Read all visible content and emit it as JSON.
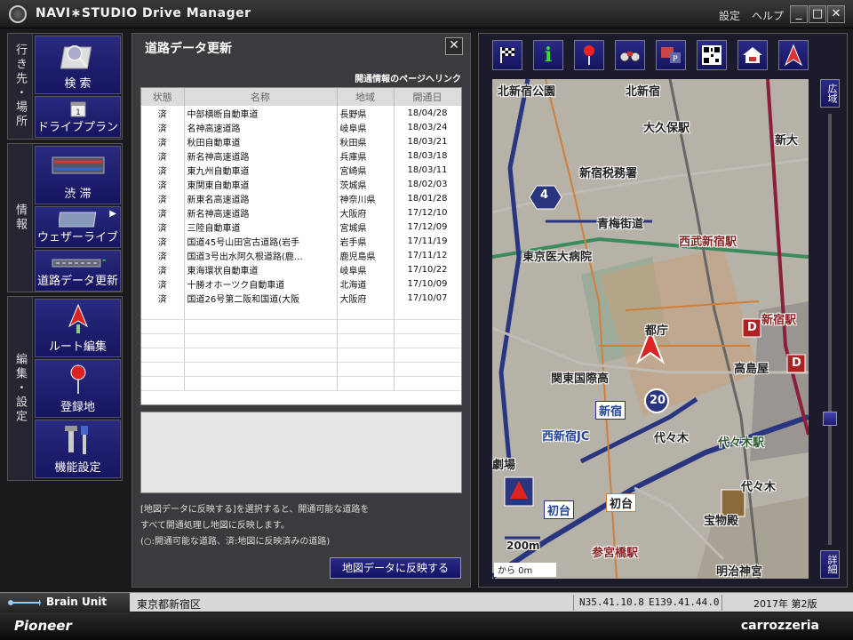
{
  "window": {
    "title": "NAVI∗STUDIO  Drive Manager",
    "settings_label": "設定",
    "help_label": "ヘルプ",
    "minimize": "_",
    "maximize": "□",
    "close": "✕"
  },
  "nav": {
    "groups": [
      {
        "label": "行き先・場所",
        "items": [
          {
            "label": "検 索",
            "icon": "search-icon"
          },
          {
            "label": "ドライブプラン",
            "icon": "calendar-icon"
          }
        ]
      },
      {
        "label": "情報",
        "items": [
          {
            "label": "渋 滞",
            "icon": "traffic-icon"
          },
          {
            "label": "ウェザーライブ",
            "icon": "weather-icon"
          },
          {
            "label": "道路データ更新",
            "icon": "road-update-icon"
          }
        ]
      },
      {
        "label": "編集・設定",
        "items": [
          {
            "label": "ルート編集",
            "icon": "route-icon"
          },
          {
            "label": "登録地",
            "icon": "pin-icon"
          },
          {
            "label": "機能設定",
            "icon": "tools-icon"
          }
        ]
      }
    ],
    "weather_arrow": "▶"
  },
  "panel": {
    "title": "道路データ更新",
    "close": "✕",
    "info_link": "開通情報のページへリンク",
    "columns": [
      "状態",
      "名称",
      "地域",
      "開通日"
    ],
    "rows": [
      [
        "済",
        "中部横断自動車道",
        "長野県",
        "18/04/28"
      ],
      [
        "済",
        "名神高速道路",
        "岐阜県",
        "18/03/24"
      ],
      [
        "済",
        "秋田自動車道",
        "秋田県",
        "18/03/21"
      ],
      [
        "済",
        "新名神高速道路",
        "兵庫県",
        "18/03/18"
      ],
      [
        "済",
        "東九州自動車道",
        "宮崎県",
        "18/03/11"
      ],
      [
        "済",
        "東関東自動車道",
        "茨城県",
        "18/02/03"
      ],
      [
        "済",
        "新東名高速道路",
        "神奈川県",
        "18/01/28"
      ],
      [
        "済",
        "新名神高速道路",
        "大阪府",
        "17/12/10"
      ],
      [
        "済",
        "三陸自動車道",
        "宮城県",
        "17/12/09"
      ],
      [
        "済",
        "国道45号山田宮古道路(岩手",
        "岩手県",
        "17/11/19"
      ],
      [
        "済",
        "国道3号出水阿久根道路(鹿…",
        "鹿児島県",
        "17/11/12"
      ],
      [
        "済",
        "東海環状自動車道",
        "岐阜県",
        "17/10/22"
      ],
      [
        "済",
        "十勝オホーツク自動車道",
        "北海道",
        "17/10/09"
      ],
      [
        "済",
        "国道26号第二阪和国道(大阪",
        "大阪府",
        "17/10/07"
      ]
    ],
    "note_lines": [
      "[地図データに反映する]を選択すると、開通可能な道路を",
      "すべて開通処理し地図に反映します。",
      "(○:開通可能な道路、済:地図に反映済みの道路)"
    ],
    "apply_button": "地図データに反映する"
  },
  "map": {
    "tools": [
      "flag-icon",
      "info-icon",
      "pin-icon",
      "binoculars-icon",
      "parking-icon",
      "qr-icon",
      "home-icon",
      "vehicle-arrow-icon"
    ],
    "info_glyph": "i",
    "zoom_out": "広域",
    "zoom_in": "詳細",
    "labels": {
      "kitashinjuku_park": "北新宿公園",
      "kitashinjuku": "北新宿",
      "okubo": "大久保駅",
      "shinokubo": "新大",
      "tax_office": "新宿税務署",
      "ome_kaido": "青梅街道",
      "seibu": "西武新宿駅",
      "tokyo_med": "東京医大病院",
      "tocho": "都庁",
      "shinjuku_sta": "新宿駅",
      "takashimaya": "高島屋",
      "kanto_kokusai": "関東国際高",
      "shinjuku": "新宿",
      "nishishinjuku_jc": "西新宿JC",
      "yoyogi": "代々木",
      "yoyogi_sta": "代々木駅",
      "hatsudai": "初台",
      "hatsudai2": "初台",
      "theater": "劇場",
      "sangubashi": "参宮橋駅",
      "meiji": "明治神宮",
      "museum": "宝物殿",
      "yoyogi2": "代々木",
      "route4": "4",
      "route20": "20",
      "scale": "200m",
      "dist": "から 0m",
      "d_mark": "D"
    }
  },
  "status": {
    "brain_unit": "Brain Unit",
    "location": "東京都新宿区",
    "lat": "N35.41.10.8",
    "lon": "E139.41.44.0",
    "version": "2017年 第2版"
  },
  "footer": {
    "brand_left": "Pioneer",
    "brand_right": "carrozzeria"
  }
}
